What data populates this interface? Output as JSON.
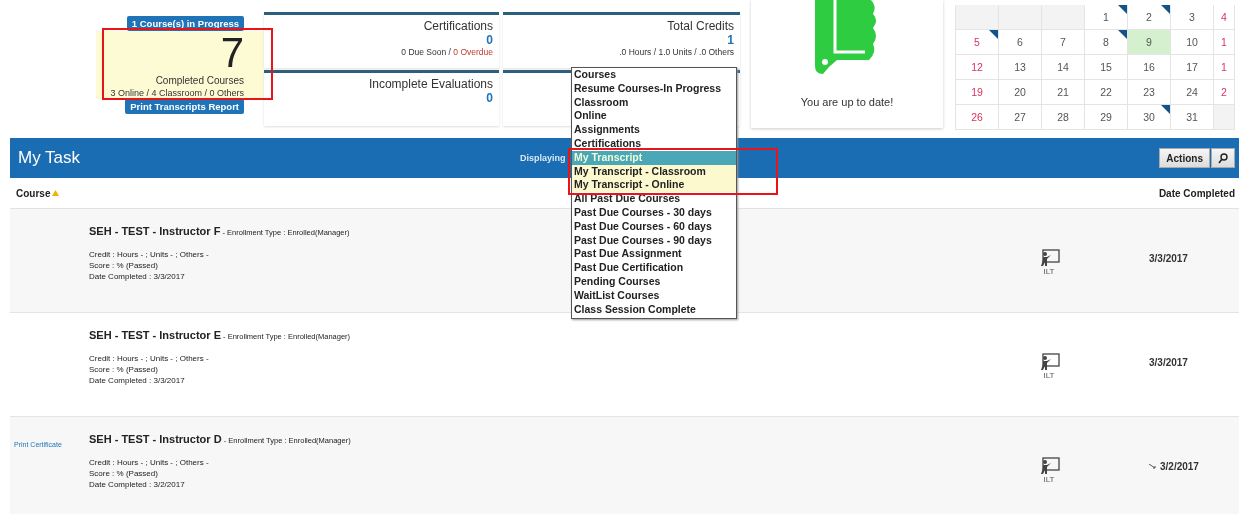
{
  "summary": {
    "in_progress_button": "1 Course(s) in Progress",
    "completed": {
      "count": "7",
      "label": "Completed Courses",
      "breakdown": "3 Online / 4 Classroom / 0 Others"
    },
    "print_button": "Print Transcripts Report"
  },
  "cards": [
    {
      "title": "Certifications",
      "value": "0",
      "detail": "0 Due Soon / ",
      "alert": "0 Overdue"
    },
    {
      "title": "Total Credits",
      "value": "1",
      "detail": ".0 Hours / 1.0 Units / .0 Others"
    },
    {
      "title": "Incomplete Evaluations",
      "value": "0"
    }
  ],
  "status_card": {
    "message": "You are up to date!"
  },
  "calendar": {
    "weeks": [
      [
        {
          "kind": "blank"
        },
        {
          "kind": "blank"
        },
        {
          "kind": "blank"
        },
        {
          "kind": "day",
          "day": "1",
          "marked": true,
          "selected": false
        },
        {
          "day": "2",
          "marked": true,
          "selected": false
        },
        {
          "day": "3",
          "marked": false,
          "selected": false
        },
        {
          "day": "4",
          "marked": false,
          "selected": false
        }
      ],
      [
        {
          "day": "5",
          "marked": true,
          "selected": false
        },
        {
          "day": "6",
          "marked": false,
          "selected": false
        },
        {
          "day": "7",
          "marked": false,
          "selected": false
        },
        {
          "day": "8",
          "marked": true,
          "selected": false
        },
        {
          "day": "9",
          "marked": false,
          "selected": true
        },
        {
          "day": "10",
          "marked": false,
          "selected": false
        },
        {
          "day": "1",
          "marked": false,
          "selected": false
        }
      ],
      [
        {
          "day": "12",
          "marked": false,
          "selected": false
        },
        {
          "day": "13",
          "marked": false,
          "selected": false
        },
        {
          "day": "14",
          "marked": false,
          "selected": false
        },
        {
          "day": "15",
          "marked": false,
          "selected": false
        },
        {
          "day": "16",
          "marked": false,
          "selected": false
        },
        {
          "day": "17",
          "marked": false,
          "selected": false
        },
        {
          "day": "1",
          "marked": false,
          "selected": false
        }
      ],
      [
        {
          "day": "19",
          "marked": false,
          "selected": false
        },
        {
          "day": "20",
          "marked": false,
          "selected": false
        },
        {
          "day": "21",
          "marked": false,
          "selected": false
        },
        {
          "day": "22",
          "marked": false,
          "selected": false
        },
        {
          "day": "23",
          "marked": false,
          "selected": false
        },
        {
          "day": "24",
          "marked": false,
          "selected": false
        },
        {
          "day": "2",
          "marked": false,
          "selected": false
        }
      ],
      [
        {
          "day": "26",
          "marked": false,
          "selected": false
        },
        {
          "day": "27",
          "marked": false,
          "selected": false
        },
        {
          "day": "28",
          "marked": false,
          "selected": false
        },
        {
          "day": "29",
          "marked": false,
          "selected": false
        },
        {
          "day": "30",
          "marked": true,
          "selected": false
        },
        {
          "day": "31",
          "marked": false,
          "selected": false
        },
        {
          "kind": "blank"
        }
      ]
    ]
  },
  "task_panel": {
    "title": "My Task",
    "displaying_label": "Displaying",
    "actions_button": "Actions",
    "columns": [
      "Course",
      "Date Completed"
    ],
    "rows": [
      {
        "link": "",
        "title": "SEH - TEST - Instructor F",
        "enrollment": " - Enrollment Type : Enrolled(Manager)",
        "credit": "Credit  : Hours - ; Units - ; Others -",
        "score": "Score : %  (Passed)",
        "date_line": "Date Completed : 3/3/2017",
        "type": "ILT",
        "date": "3/3/2017",
        "date_icon": false
      },
      {
        "link": "",
        "title": "SEH - TEST - Instructor E",
        "enrollment": " - Enrollment Type : Enrolled(Manager)",
        "credit": "Credit  : Hours - ; Units - ; Others -",
        "score": "Score : %  (Passed)",
        "date_line": "Date Completed : 3/3/2017",
        "type": "ILT",
        "date": "3/3/2017",
        "date_icon": false
      },
      {
        "link": "Print Certificate",
        "title": "SEH - TEST - Instructor D",
        "enrollment": " - Enrollment Type : Enrolled(Manager)",
        "credit": "Credit  : Hours - ; Units - ; Others -",
        "score": "Score : %  (Passed)",
        "date_line": "Date Completed :  3/2/2017",
        "type": "ILT",
        "date": "3/2/2017",
        "date_icon": true
      }
    ]
  },
  "dropdown": {
    "items": [
      {
        "label": "Courses",
        "selected": false,
        "highlighted": false
      },
      {
        "label": "Resume Courses-In Progress",
        "selected": false,
        "highlighted": false
      },
      {
        "label": "Classroom",
        "selected": false,
        "highlighted": false
      },
      {
        "label": "Online",
        "selected": false,
        "highlighted": false
      },
      {
        "label": "Assignments",
        "selected": false,
        "highlighted": false
      },
      {
        "label": "Certifications",
        "selected": false,
        "highlighted": false
      },
      {
        "label": "My Transcript",
        "selected": true,
        "highlighted": false
      },
      {
        "label": "My Transcript - Classroom",
        "selected": false,
        "highlighted": true
      },
      {
        "label": "My Transcript - Online",
        "selected": false,
        "highlighted": true
      },
      {
        "label": "All Past Due Courses",
        "selected": false,
        "highlighted": false
      },
      {
        "label": "Past Due Courses - 30 days",
        "selected": false,
        "highlighted": false
      },
      {
        "label": "Past Due Courses - 60 days",
        "selected": false,
        "highlighted": false
      },
      {
        "label": "Past Due Courses - 90 days",
        "selected": false,
        "highlighted": false
      },
      {
        "label": "Past Due Assignment",
        "selected": false,
        "highlighted": false
      },
      {
        "label": "Past Due Certification",
        "selected": false,
        "highlighted": false
      },
      {
        "label": "Pending Courses",
        "selected": false,
        "highlighted": false
      },
      {
        "label": "WaitList Courses",
        "selected": false,
        "highlighted": false
      },
      {
        "label": "Class Session Complete",
        "selected": false,
        "highlighted": false
      }
    ]
  }
}
